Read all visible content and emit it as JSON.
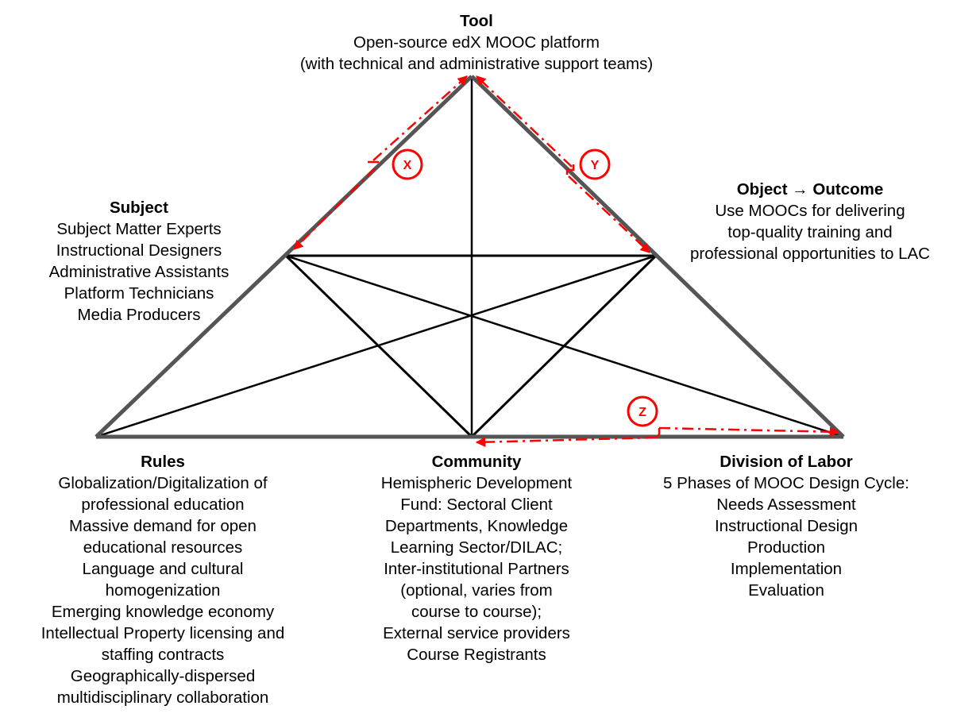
{
  "diagram": {
    "type": "activity-system-triangle",
    "accent_color": "#ff0000",
    "outer_line_color": "#555555",
    "inner_line_color": "#000000"
  },
  "nodes": {
    "tool": {
      "title": "Tool",
      "lines": [
        "Open-source edX MOOC platform",
        "(with technical and administrative support teams)"
      ]
    },
    "subject": {
      "title": "Subject",
      "lines": [
        "Subject Matter Experts",
        "Instructional Designers",
        "Administrative Assistants",
        "Platform Technicians",
        "Media Producers"
      ]
    },
    "object": {
      "title": "Object → Outcome",
      "lines": [
        "Use MOOCs for delivering",
        "top-quality training and",
        "professional opportunities to LAC"
      ]
    },
    "rules": {
      "title": "Rules",
      "lines": [
        "Globalization/Digitalization of",
        "professional education",
        "Massive demand for open",
        "educational resources",
        "Language and cultural",
        "homogenization",
        "Emerging knowledge economy",
        "Intellectual Property licensing and",
        "staffing contracts",
        "Geographically-dispersed",
        "multidisciplinary collaboration"
      ]
    },
    "community": {
      "title": "Community",
      "lines": [
        "Hemispheric Development",
        "Fund: Sectoral Client",
        "Departments, Knowledge",
        "Learning Sector/DILAC;",
        "Inter-institutional Partners",
        "(optional, varies from",
        "course to course);",
        "External service providers",
        "Course Registrants"
      ]
    },
    "division_of_labor": {
      "title": "Division of Labor",
      "lines": [
        "5 Phases of MOOC Design Cycle:",
        "Needs Assessment",
        "Instructional Design",
        "Production",
        "Implementation",
        "Evaluation"
      ]
    }
  },
  "markers": {
    "x": "X",
    "y": "Y",
    "z": "Z"
  }
}
